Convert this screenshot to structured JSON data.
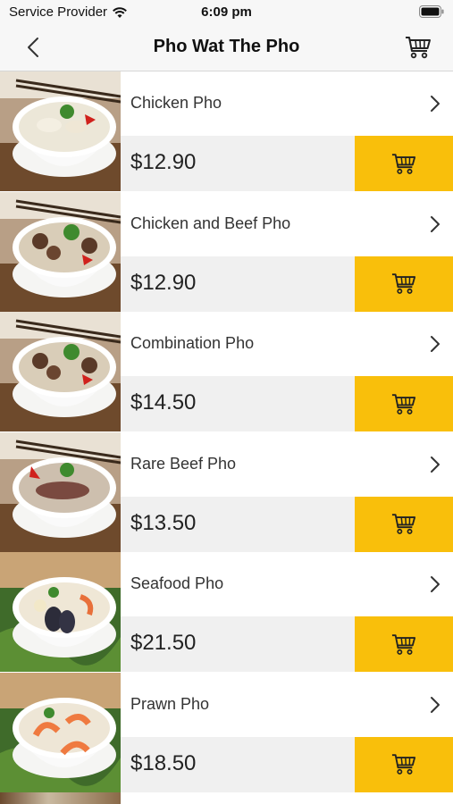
{
  "status": {
    "carrier": "Service Provider",
    "time": "6:09 pm"
  },
  "nav": {
    "title": "Pho Wat The Pho"
  },
  "colors": {
    "accent": "#f9bf0b",
    "price_bg": "#f0f0f0"
  },
  "items": [
    {
      "name": "Chicken Pho",
      "price": "$12.90",
      "kind": "chicken"
    },
    {
      "name": "Chicken and Beef Pho",
      "price": "$12.90",
      "kind": "beef"
    },
    {
      "name": "Combination Pho",
      "price": "$14.50",
      "kind": "beef"
    },
    {
      "name": "Rare Beef Pho",
      "price": "$13.50",
      "kind": "rare"
    },
    {
      "name": "Seafood Pho",
      "price": "$21.50",
      "kind": "seafood"
    },
    {
      "name": "Prawn Pho",
      "price": "$18.50",
      "kind": "prawn"
    }
  ]
}
